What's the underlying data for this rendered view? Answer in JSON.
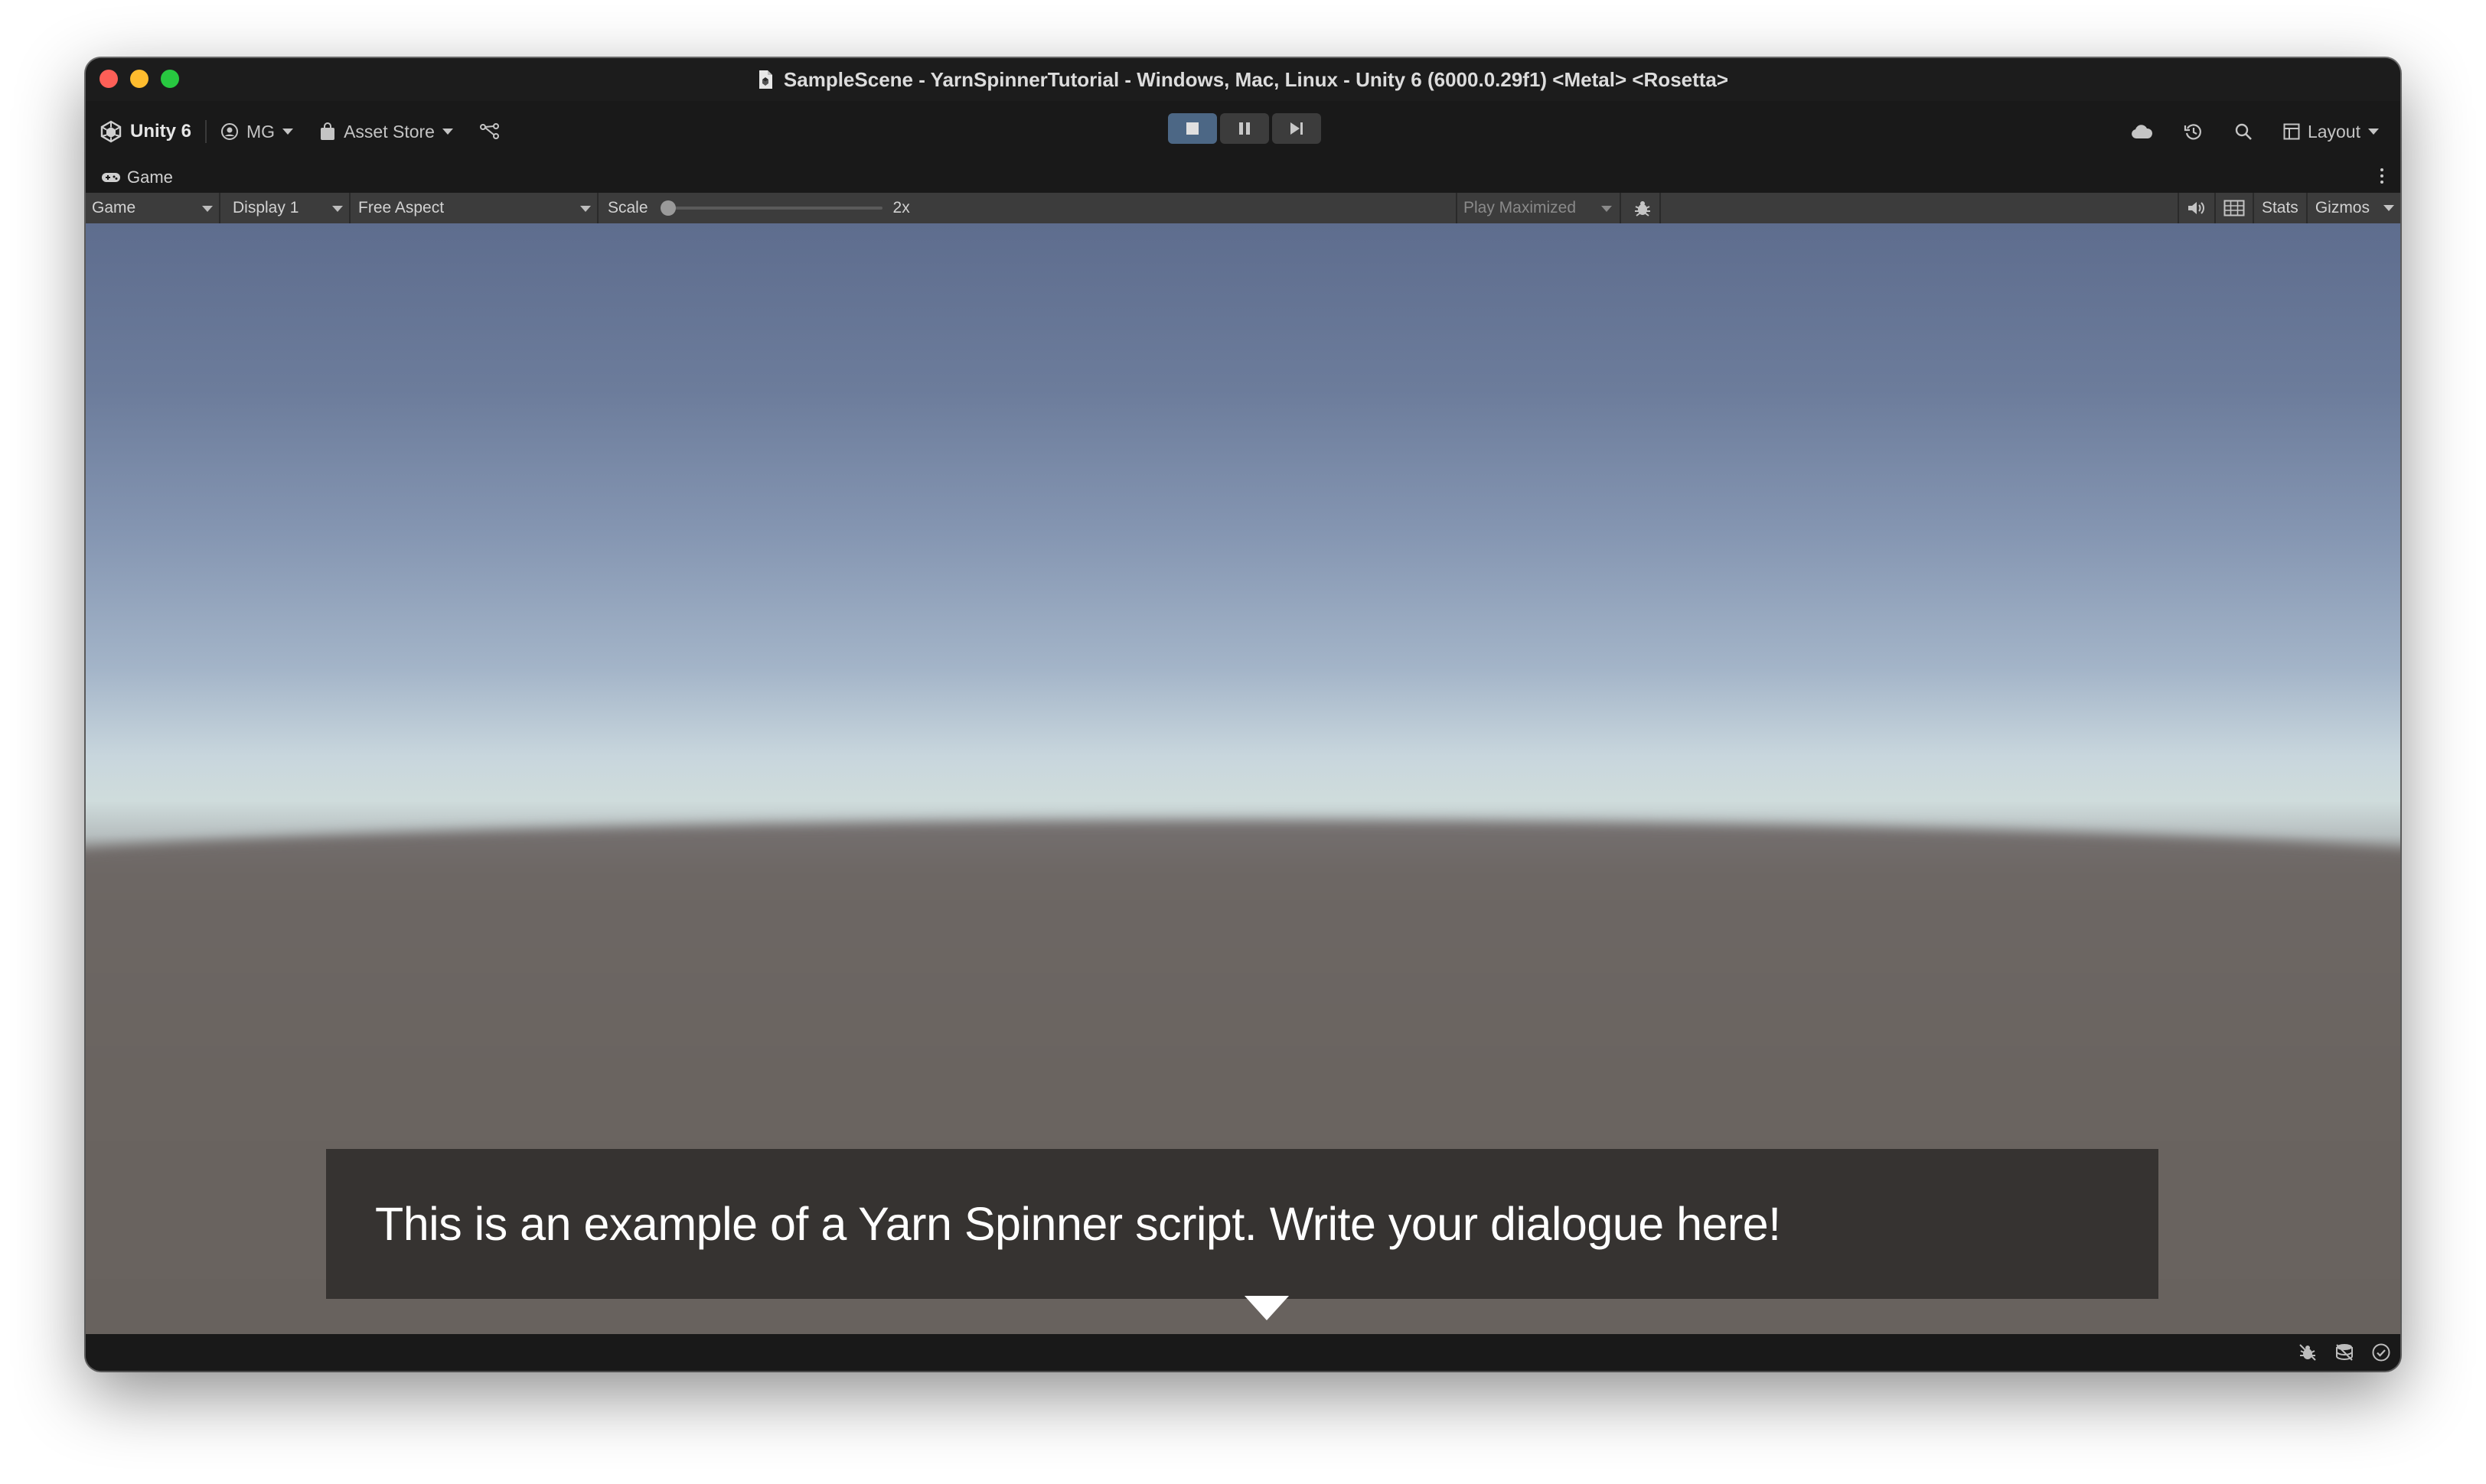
{
  "window": {
    "title": "SampleScene - YarnSpinnerTutorial - Windows, Mac, Linux - Unity 6 (6000.0.29f1) <Metal> <Rosetta>"
  },
  "toolbar": {
    "unity_label": "Unity 6",
    "account_label": "MG",
    "asset_store_label": "Asset Store",
    "layout_label": "Layout",
    "play_state": "playing"
  },
  "tab": {
    "label": "Game"
  },
  "game_toolbar": {
    "view_dropdown": "Game",
    "display_dropdown": "Display 1",
    "aspect_dropdown": "Free Aspect",
    "scale_label": "Scale",
    "scale_value": "2x",
    "scale_slider_fraction": 0,
    "play_mode_dropdown": "Play Maximized",
    "stats_label": "Stats",
    "gizmos_label": "Gizmos"
  },
  "game_view": {
    "dialogue_text": "This is an example of a Yarn Spinner script. Write your dialogue here!"
  },
  "colors": {
    "play_active": "#4c6785",
    "sky_top": "#5e6d8e",
    "horizon": "#cfdcdc",
    "ground": "#6a6460",
    "dialogue_bg": "#363331"
  }
}
